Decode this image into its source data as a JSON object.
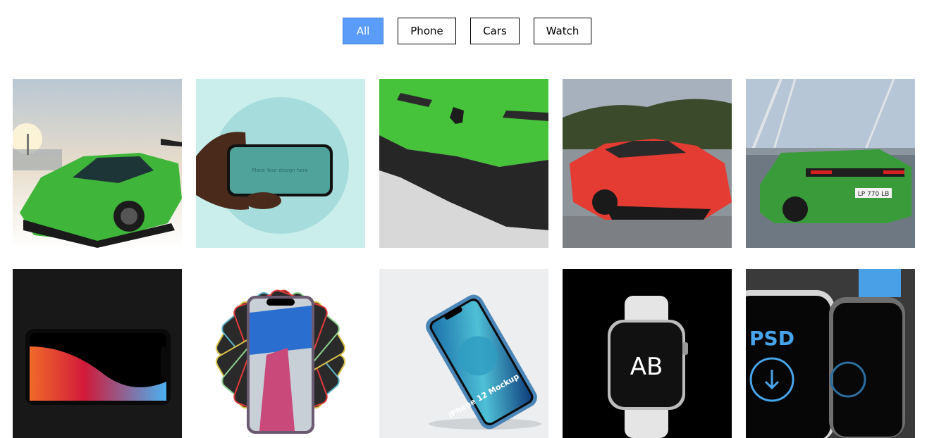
{
  "filters": [
    {
      "label": "All",
      "active": true
    },
    {
      "label": "Phone",
      "active": false
    },
    {
      "label": "Cars",
      "active": false
    },
    {
      "label": "Watch",
      "active": false
    }
  ],
  "gallery": {
    "items": [
      {
        "category": "Cars",
        "subject": "green-supercar"
      },
      {
        "category": "Phone",
        "subject": "hand-holding-phone",
        "screen_text": "Place Your design here"
      },
      {
        "category": "Cars",
        "subject": "green-car-front-closeup"
      },
      {
        "category": "Cars",
        "subject": "red-supercar-road"
      },
      {
        "category": "Cars",
        "subject": "green-supercar-rear",
        "plate_text": "LP 770 LB"
      },
      {
        "category": "Phone",
        "subject": "black-phone-landscape"
      },
      {
        "category": "Phone",
        "subject": "phone-fan-mockup"
      },
      {
        "category": "Phone",
        "subject": "iphone-12-mockup",
        "screen_text": "iPhone 12 Mockup"
      },
      {
        "category": "Watch",
        "subject": "watch-ab-logo",
        "logo_text": "AB"
      },
      {
        "category": "Watch",
        "subject": "watch-psd-download",
        "screen_text": "PSD"
      }
    ]
  },
  "colors": {
    "active_filter": "#5a9cf8",
    "border": "#000000",
    "background": "#ffffff"
  }
}
